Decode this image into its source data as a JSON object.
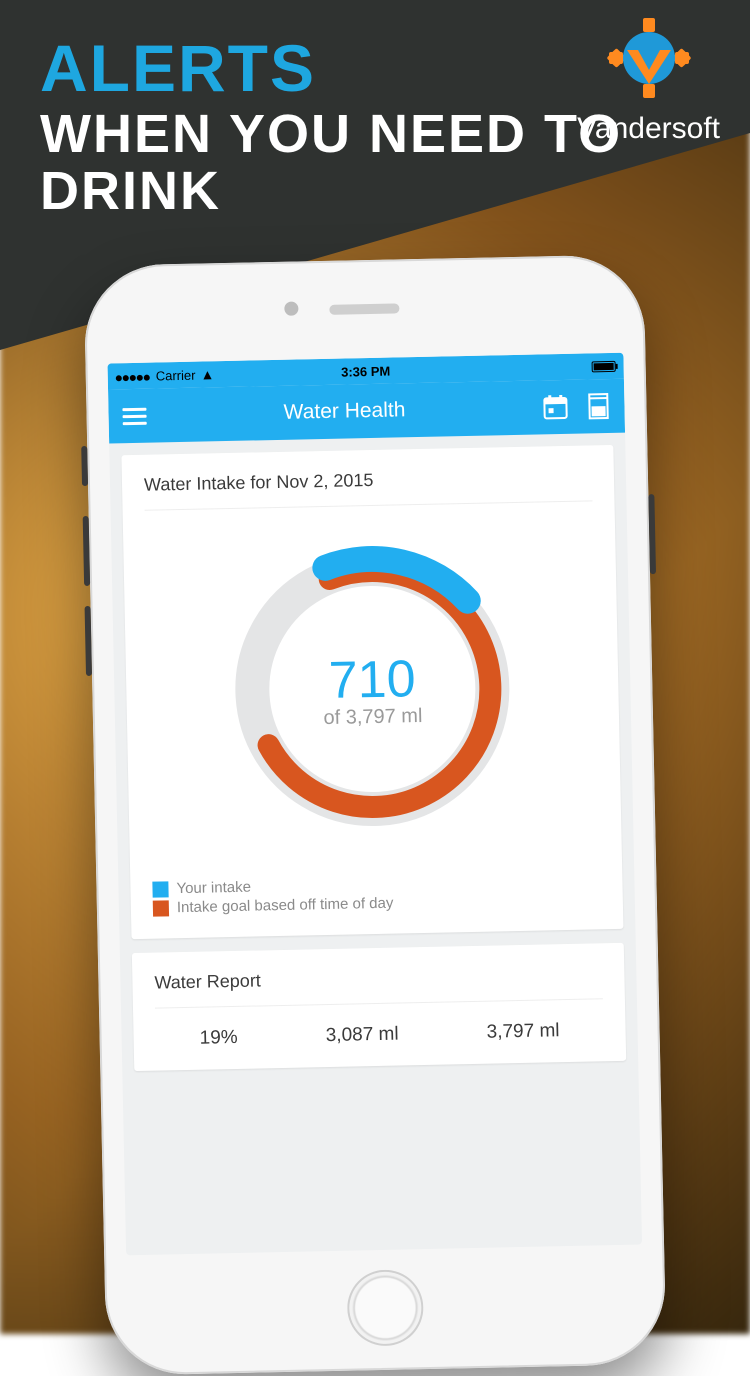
{
  "promo": {
    "headline_accent": "ALERTS",
    "headline_rest": "WHEN YOU NEED TO DRINK",
    "brand": "Vandersoft"
  },
  "status": {
    "carrier": "Carrier",
    "time": "3:36 PM"
  },
  "navbar": {
    "title": "Water Health"
  },
  "intake_card": {
    "title": "Water Intake for Nov 2, 2015",
    "value": "710",
    "goal_line": "of 3,797 ml",
    "legend_intake": "Your intake",
    "legend_goal": "Intake goal based off time of day"
  },
  "report_card": {
    "title": "Water Report",
    "cells": [
      "19%",
      "3,087 ml",
      "3,797 ml"
    ]
  },
  "chart_data": {
    "type": "pie",
    "title": "Water Intake for Nov 2, 2015",
    "unit": "ml",
    "total_goal": 3797,
    "series": [
      {
        "name": "Your intake",
        "value": 710,
        "fraction": 0.19,
        "color": "#22aef0"
      },
      {
        "name": "Intake goal based off time of day",
        "value": 2790,
        "fraction": 0.73,
        "color": "#d8561f"
      }
    ],
    "start_angle_deg": -20
  },
  "colors": {
    "accent": "#22aef0",
    "goal": "#d8561f",
    "track": "#e4e5e6"
  }
}
